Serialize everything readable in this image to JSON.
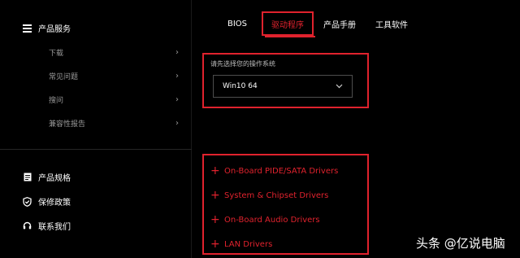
{
  "sidebar": {
    "section_title": "产品服务",
    "sub_items": [
      {
        "label": "下载"
      },
      {
        "label": "常见问题"
      },
      {
        "label": "搜问"
      },
      {
        "label": "兼容性报告"
      }
    ],
    "bottom_items": [
      {
        "label": "产品规格",
        "icon": "document-icon"
      },
      {
        "label": "保修政策",
        "icon": "shield-check-icon"
      },
      {
        "label": "联系我们",
        "icon": "headset-icon"
      }
    ]
  },
  "tabs": [
    {
      "label": "BIOS"
    },
    {
      "label": "驱动程序",
      "active": true
    },
    {
      "label": "产品手册"
    },
    {
      "label": "工具软件"
    }
  ],
  "os_select": {
    "label": "请先选择您的操作系统",
    "value": "Win10 64"
  },
  "drivers": [
    {
      "label": "On-Board PIDE/SATA Drivers"
    },
    {
      "label": "System & Chipset Drivers"
    },
    {
      "label": "On-Board Audio Drivers"
    },
    {
      "label": "LAN Drivers"
    }
  ],
  "watermark": "头条 @亿说电脑",
  "colors": {
    "accent": "#e0222d",
    "background": "#000000"
  }
}
